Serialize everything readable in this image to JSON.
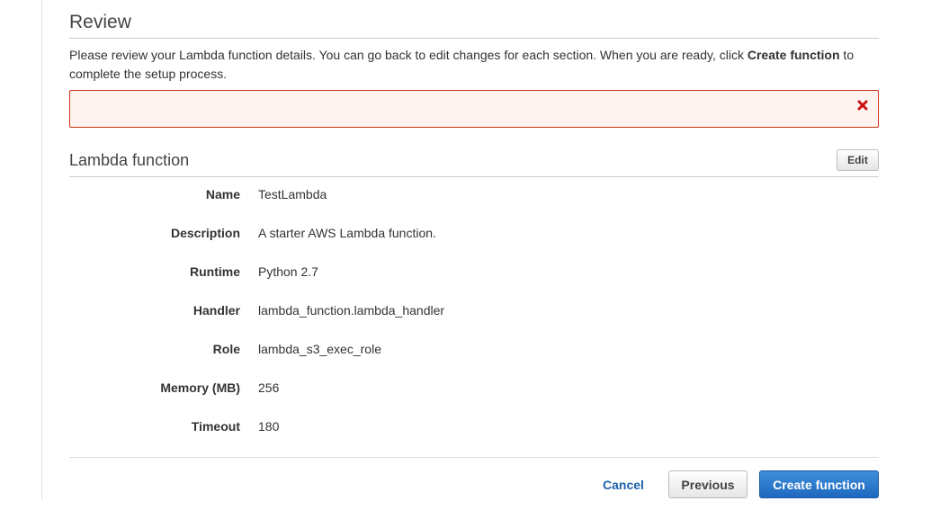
{
  "page": {
    "title": "Review",
    "intro_before": "Please review your Lambda function details. You can go back to edit changes for each section. When you are ready, click ",
    "intro_bold": "Create function",
    "intro_after": " to complete the setup process."
  },
  "error_banner": {
    "close_icon": "close-x-icon",
    "accent_color": "#d13212"
  },
  "section": {
    "title": "Lambda function",
    "edit_label": "Edit"
  },
  "details": [
    {
      "label": "Name",
      "value": "TestLambda"
    },
    {
      "label": "Description",
      "value": "A starter AWS Lambda function."
    },
    {
      "label": "Runtime",
      "value": "Python 2.7"
    },
    {
      "label": "Handler",
      "value": "lambda_function.lambda_handler"
    },
    {
      "label": "Role",
      "value": "lambda_s3_exec_role"
    },
    {
      "label": "Memory (MB)",
      "value": "256"
    },
    {
      "label": "Timeout",
      "value": "180"
    }
  ],
  "footer": {
    "cancel_label": "Cancel",
    "previous_label": "Previous",
    "create_label": "Create function",
    "primary_color": "#1d68bf"
  }
}
